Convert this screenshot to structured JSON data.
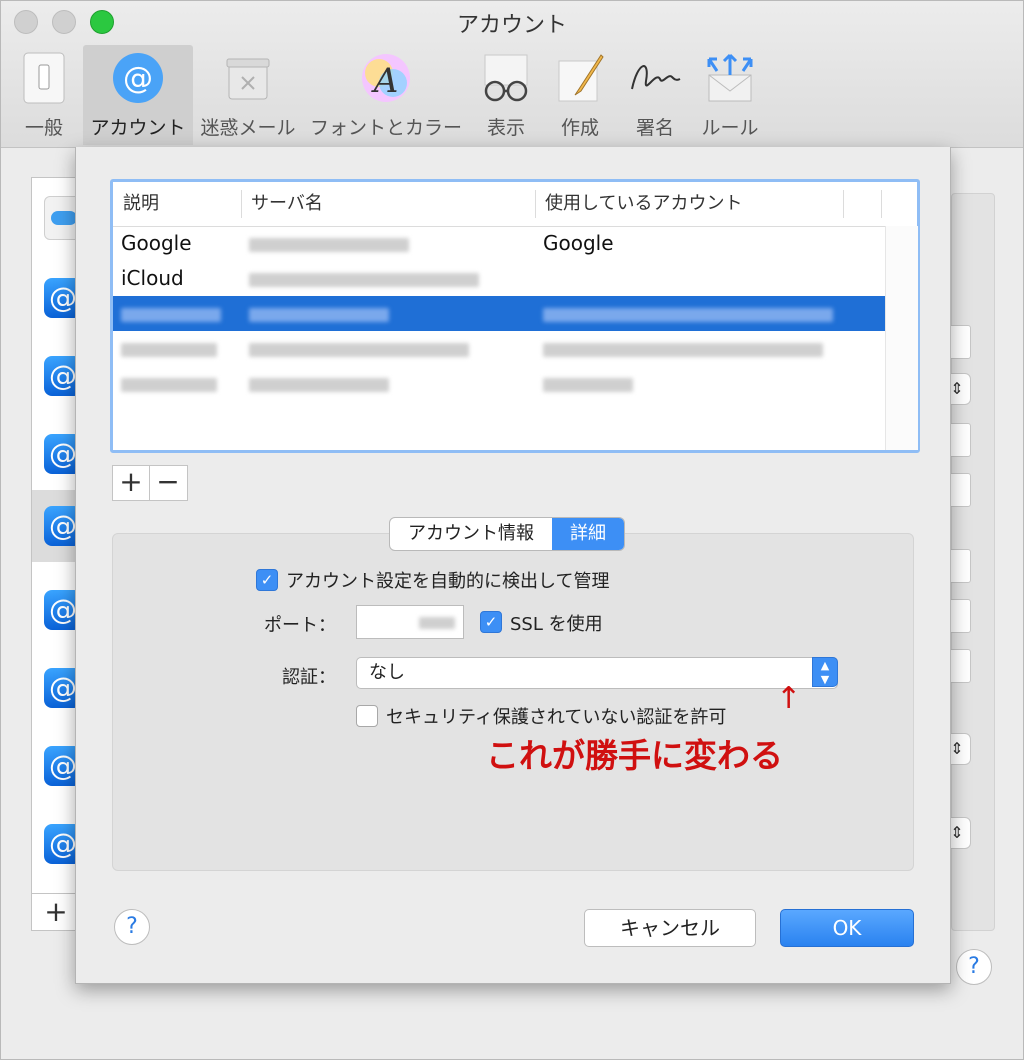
{
  "window": {
    "title": "アカウント"
  },
  "toolbar": {
    "items": [
      {
        "label": "一般",
        "icon": "switch-icon"
      },
      {
        "label": "アカウント",
        "icon": "at-sign-icon",
        "active": true
      },
      {
        "label": "迷惑メール",
        "icon": "junk-trash-icon"
      },
      {
        "label": "フォントとカラー",
        "icon": "font-color-icon"
      },
      {
        "label": "表示",
        "icon": "glasses-icon"
      },
      {
        "label": "作成",
        "icon": "compose-pencil-icon"
      },
      {
        "label": "署名",
        "icon": "signature-icon"
      },
      {
        "label": "ルール",
        "icon": "rules-envelope-icon"
      }
    ]
  },
  "table": {
    "headers": [
      "説明",
      "サーバ名",
      "使用しているアカウント"
    ],
    "rows": [
      {
        "description": "Google",
        "server": "",
        "account": "Google"
      },
      {
        "description": "iCloud",
        "server": "",
        "account": ""
      }
    ]
  },
  "list_controls": {
    "add": "+",
    "remove": "−"
  },
  "tabs": [
    {
      "label": "アカウント情報",
      "active": false
    },
    {
      "label": "詳細",
      "active": true
    }
  ],
  "details": {
    "auto_detect_label": "アカウント設定を自動的に検出して管理",
    "auto_detect_checked": true,
    "port_label": "ポート：",
    "ssl_label": "SSL を使用",
    "ssl_checked": true,
    "auth_label": "認証：",
    "auth_value": "なし",
    "insecure_auth_label": "セキュリティ保護されていない認証を許可",
    "insecure_auth_checked": false
  },
  "annotation": {
    "arrow": "↑",
    "text": "これが勝手に変わる",
    "color": "#d01010"
  },
  "buttons": {
    "help": "?",
    "cancel": "キャンセル",
    "ok": "OK"
  },
  "colors": {
    "accent": "#3d8ff5",
    "selection": "#1f6fd6"
  }
}
